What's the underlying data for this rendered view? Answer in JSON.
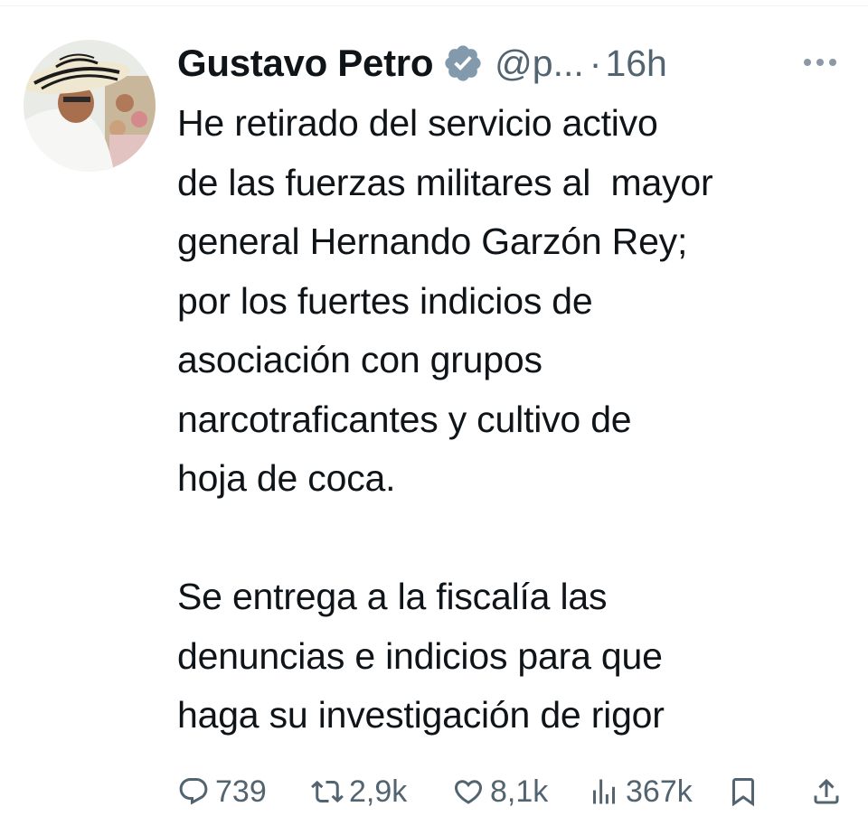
{
  "tweet": {
    "author": {
      "display_name": "Gustavo Petro",
      "handle": "@p...",
      "verified": true,
      "avatar_icon": "profile-photo"
    },
    "separator": "·",
    "timestamp": "16h",
    "more_icon": "more-horizontal-icon",
    "text_lines": [
      "He retirado del servicio activo",
      "de las fuerzas militares al  mayor",
      "general Hernando Garzón Rey;",
      "por los fuertes indicios de",
      "asociación con grupos",
      "narcotraficantes y cultivo de",
      "hoja de coca.",
      "",
      "Se entrega a la fiscalía las",
      "denuncias e indicios para que",
      "haga su investigación de rigor"
    ],
    "actions": {
      "reply_count": "739",
      "retweet_count": "2,9k",
      "like_count": "8,1k",
      "views_count": "367k"
    }
  },
  "colors": {
    "text_primary": "#0f1419",
    "text_secondary": "#536471",
    "verified_badge": "#829aab",
    "divider": "#eff3f4"
  }
}
